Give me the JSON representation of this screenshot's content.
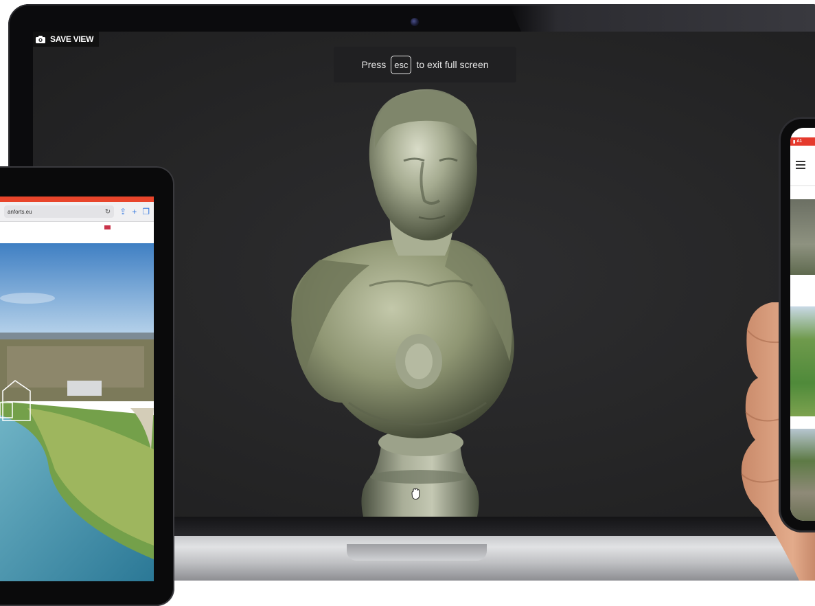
{
  "laptop": {
    "save_view": {
      "label": "SAVE VIEW",
      "icon": "camera-icon"
    },
    "fullscreen_hint": {
      "before": "Press",
      "key": "esc",
      "after": "to exit full screen"
    },
    "viewer": {
      "subject": "3d-bust-model",
      "cursor": "grab-hand-icon"
    }
  },
  "tablet": {
    "url": "anforts.eu",
    "reload_icon": "reload-icon",
    "share_icon": "share-icon",
    "add_tab_icon": "plus-icon",
    "tabs_icon": "tabs-icon",
    "status_color": "#e8452b"
  },
  "phone": {
    "carrier": "A1",
    "menu_icon": "hamburger-icon",
    "accent_color": "#e53a2d"
  }
}
